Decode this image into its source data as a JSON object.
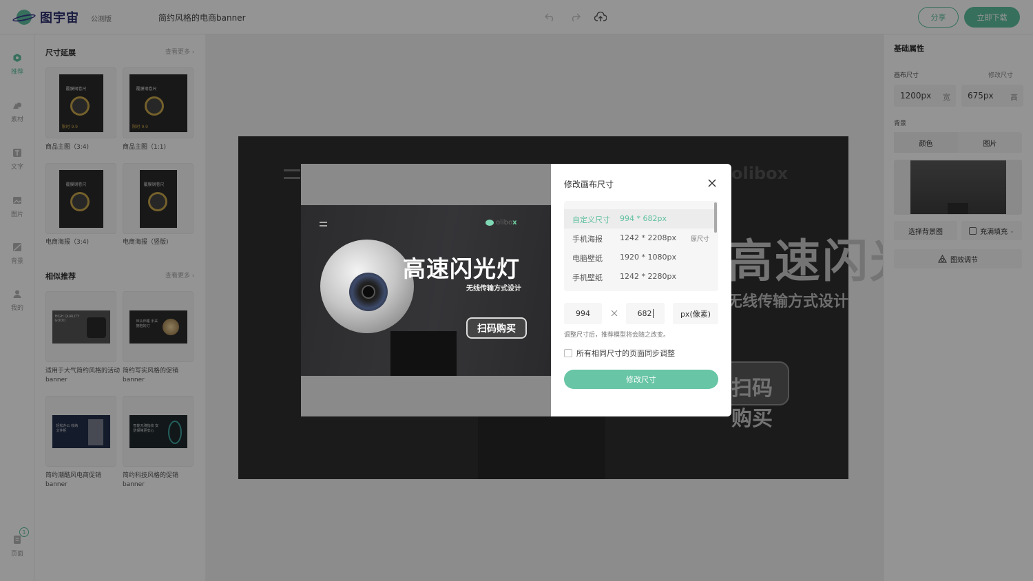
{
  "header": {
    "logo_text": "图宇宙",
    "beta_label": "公测版",
    "doc_title": "简约风格的电商banner",
    "share_label": "分享",
    "download_label": "立即下载"
  },
  "nav": {
    "items": [
      {
        "label": "推荐",
        "icon": "recommend-icon"
      },
      {
        "label": "素材",
        "icon": "shapes-icon"
      },
      {
        "label": "文字",
        "icon": "text-icon"
      },
      {
        "label": "图片",
        "icon": "image-icon"
      },
      {
        "label": "背景",
        "icon": "background-icon"
      },
      {
        "label": "我的",
        "icon": "user-icon"
      }
    ],
    "pages_label": "页面",
    "pages_count": "1"
  },
  "left_panel": {
    "size_section_title": "尺寸延展",
    "size_more": "查看更多",
    "size_cards": [
      {
        "label": "商品主图（3:4)",
        "thumb_title": "覆膜钢卷尺",
        "thumb_tag": "限时",
        "thumb_price": "9.9"
      },
      {
        "label": "商品主图（1:1)",
        "thumb_title": "覆膜钢卷尺",
        "thumb_tag": "限时",
        "thumb_price": "9.9"
      },
      {
        "label": "电商海报（3:4)",
        "thumb_title": "覆膜钢卷尺",
        "thumb_tag": "",
        "thumb_price": ""
      },
      {
        "label": "电商海报（竖版)",
        "thumb_title": "覆膜钢卷尺",
        "thumb_tag": "",
        "thumb_price": ""
      }
    ],
    "similar_section_title": "相似推荐",
    "similar_more": "查看更多",
    "similar_cards": [
      {
        "label": "适用于大气简约风格的活动banner",
        "thumb_text": "HIGH QUALITY GOOD"
      },
      {
        "label": "简约写实风格的促销banner",
        "thumb_text": "床头伴睡 手采拥抱的灯"
      },
      {
        "label": "简约潮酷风电商促销banner",
        "thumb_text": "轻松办公 收纳文件柜"
      },
      {
        "label": "简约科技风格的促销banner",
        "thumb_text": "智能无骑指纹 安防保障更安心"
      }
    ]
  },
  "canvas": {
    "bg_title": "高速闪光灯",
    "bg_subtitle": "无线传输方式设计",
    "bg_button": "扫码购买",
    "bg_brand": "olibox"
  },
  "right_panel": {
    "title": "基础属性",
    "canvas_size_label": "画布尺寸",
    "modify_size_link": "修改尺寸",
    "width_value": "1200px",
    "width_unit": "宽",
    "height_value": "675px",
    "height_unit": "高",
    "background_label": "背景",
    "tabs": [
      "颜色",
      "图片"
    ],
    "choose_bg_label": "选择背景图",
    "fill_mode_label": "充满填充",
    "effects_label": "图效调节"
  },
  "modal": {
    "title": "修改画布尺寸",
    "preview": {
      "title": "高速闪光灯",
      "subtitle": "无线传输方式设计",
      "button": "扫码购买",
      "brand_left": "olibo",
      "brand_right": "x"
    },
    "sizes": [
      {
        "name": "自定义尺寸",
        "dims": "994 * 682px",
        "tag": "",
        "selected": true
      },
      {
        "name": "手机海报",
        "dims": "1242 * 2208px",
        "tag": "原尺寸",
        "selected": false
      },
      {
        "name": "电脑壁纸",
        "dims": "1920 * 1080px",
        "tag": "",
        "selected": false
      },
      {
        "name": "手机壁纸",
        "dims": "1242 * 2280px",
        "tag": "",
        "selected": false
      }
    ],
    "width_input": "994",
    "height_input": "682",
    "unit_label": "px(像素)",
    "hint": "调整尺寸后，推荐模型将会随之改变。",
    "sync_label": "所有相同尺寸的页面同步调整",
    "submit_label": "修改尺寸"
  },
  "colors": {
    "accent": "#5fc0a0",
    "overlay": "rgba(0,0,0,0.42)"
  }
}
